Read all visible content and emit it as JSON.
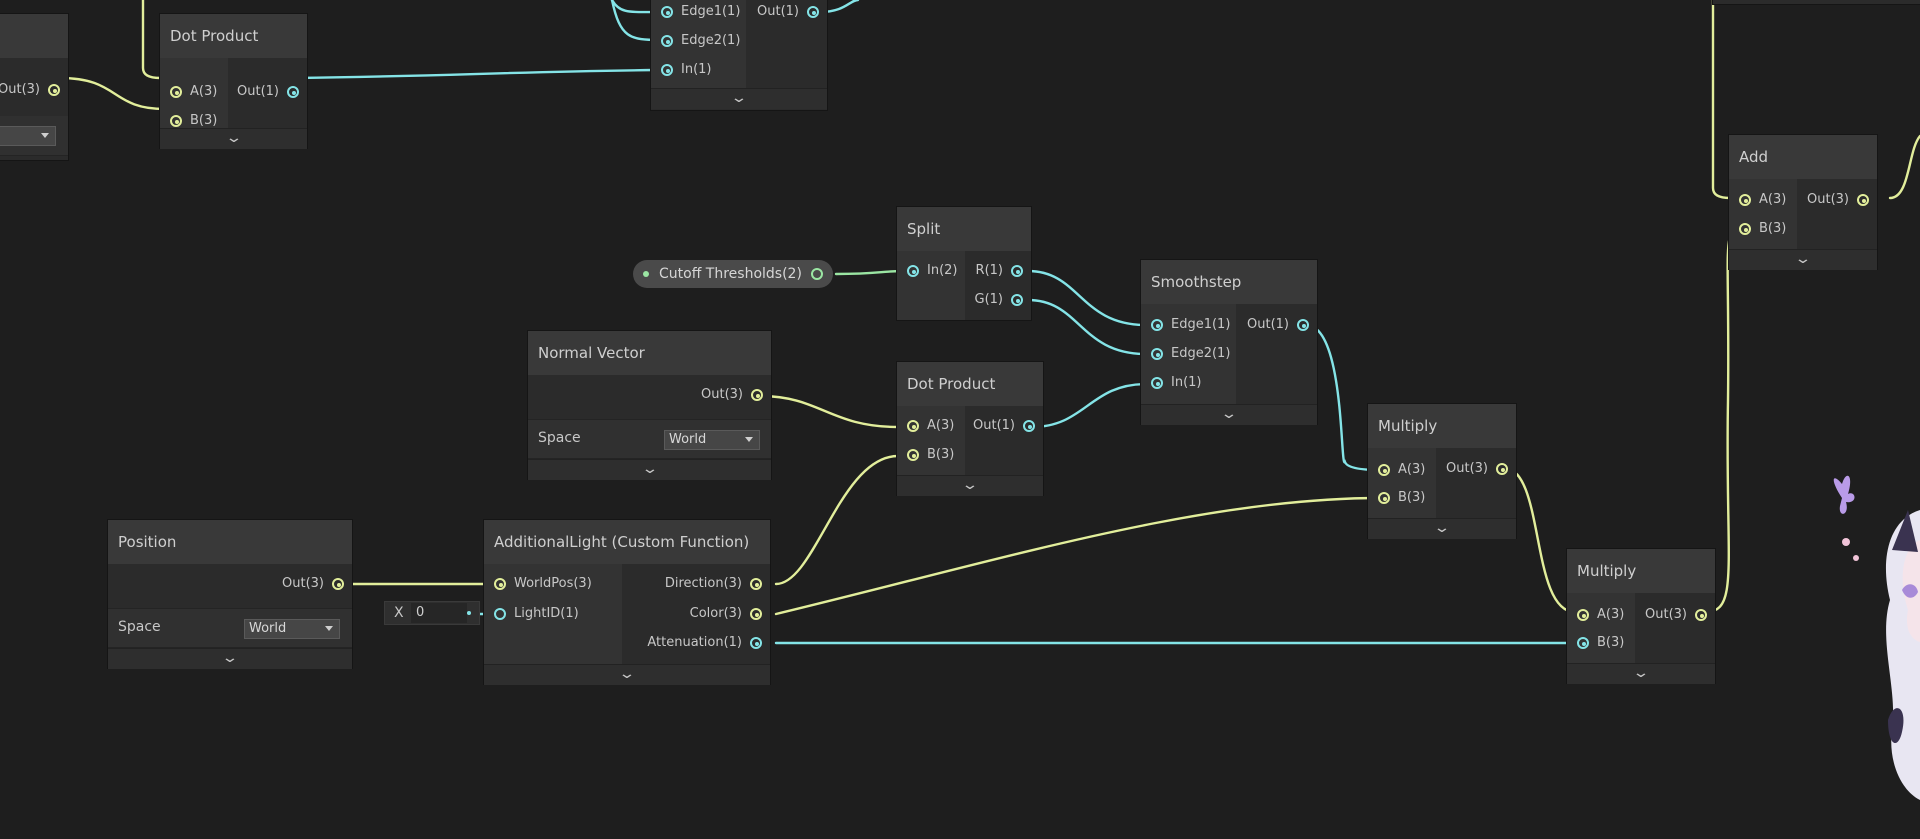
{
  "colors": {
    "background": "#1e1e1e",
    "vector3_wire": "#e2ee9b",
    "float_wire": "#84e4e7",
    "vector2_wire": "#9be6a3",
    "node_header": "#393939",
    "node_body": "#2b2b2b"
  },
  "nodes": {
    "partial_left": {
      "out": "Out(3)"
    },
    "dot_product_top": {
      "title": "Dot Product",
      "in": [
        "A(3)",
        "B(3)"
      ],
      "out": "Out(1)"
    },
    "smoothstep_top": {
      "in": [
        "Edge1(1)",
        "Edge2(1)",
        "In(1)"
      ],
      "out": "Out(1)"
    },
    "add": {
      "title": "Add",
      "in": [
        "A(3)",
        "B(3)"
      ],
      "out": "Out(3)"
    },
    "split": {
      "title": "Split",
      "in": "In(2)",
      "out": [
        "R(1)",
        "G(1)"
      ]
    },
    "smoothstep": {
      "title": "Smoothstep",
      "in": [
        "Edge1(1)",
        "Edge2(1)",
        "In(1)"
      ],
      "out": "Out(1)"
    },
    "normal_vector": {
      "title": "Normal Vector",
      "out": "Out(3)",
      "field_label": "Space",
      "field_value": "World"
    },
    "dot_product": {
      "title": "Dot Product",
      "in": [
        "A(3)",
        "B(3)"
      ],
      "out": "Out(1)"
    },
    "multiply_1": {
      "title": "Multiply",
      "in": [
        "A(3)",
        "B(3)"
      ],
      "out": "Out(3)"
    },
    "multiply_2": {
      "title": "Multiply",
      "in": [
        "A(3)",
        "B(3)"
      ],
      "out": "Out(3)"
    },
    "position": {
      "title": "Position",
      "out": "Out(3)",
      "field_label": "Space",
      "field_value": "World"
    },
    "additional_light": {
      "title": "AdditionalLight (Custom Function)",
      "in": [
        "WorldPos(3)",
        "LightID(1)"
      ],
      "out": [
        "Direction(3)",
        "Color(3)",
        "Attenuation(1)"
      ]
    }
  },
  "property": {
    "label": "Cutoff Thresholds(2)"
  },
  "light_id_field": {
    "axis": "X",
    "value": "0"
  },
  "icons": {
    "collapse": "chevron-down-icon",
    "dropdown": "dropdown-arrow-icon",
    "port": "port-dot-icon"
  }
}
